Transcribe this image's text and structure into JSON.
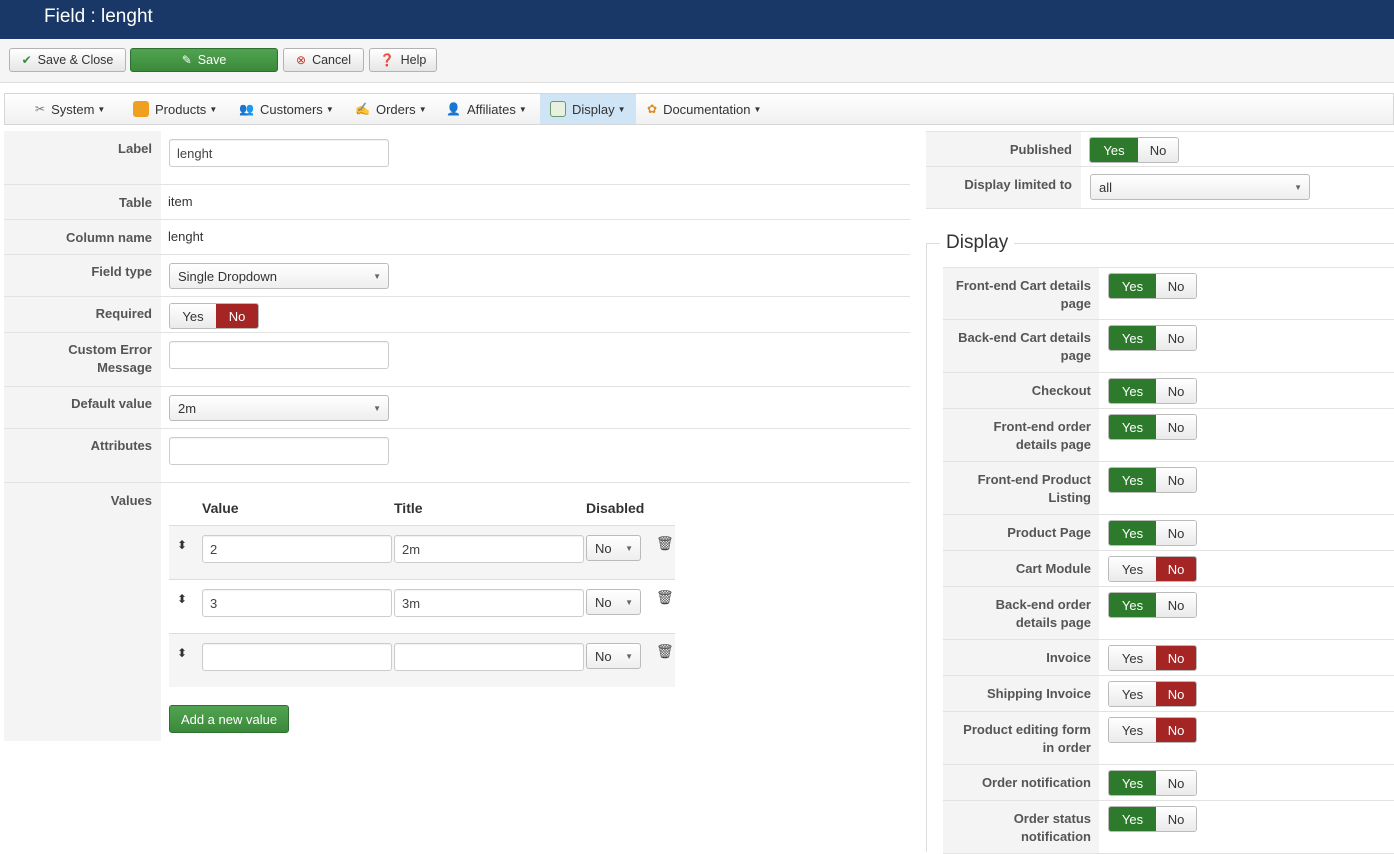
{
  "title": "Field : lenght",
  "toolbar": {
    "save_close": "Save & Close",
    "save": "Save",
    "cancel": "Cancel",
    "help": "Help"
  },
  "menu": [
    {
      "label": "System",
      "icon": "tools-icon"
    },
    {
      "label": "Products",
      "icon": "products-icon"
    },
    {
      "label": "Customers",
      "icon": "customers-icon"
    },
    {
      "label": "Orders",
      "icon": "orders-icon"
    },
    {
      "label": "Affiliates",
      "icon": "affiliates-icon"
    },
    {
      "label": "Display",
      "icon": "display-icon",
      "active": true
    },
    {
      "label": "Documentation",
      "icon": "documentation-icon"
    }
  ],
  "form": {
    "label": {
      "label": "Label",
      "value": "lenght"
    },
    "table": {
      "label": "Table",
      "value": "item"
    },
    "column_name": {
      "label": "Column name",
      "value": "lenght"
    },
    "field_type": {
      "label": "Field type",
      "value": "Single Dropdown"
    },
    "required": {
      "label": "Required",
      "yes": "Yes",
      "no": "No",
      "selected": "no"
    },
    "custom_error": {
      "label_1": "Custom Error",
      "label_2": "Message",
      "value": ""
    },
    "default_value": {
      "label": "Default value",
      "value": "2m"
    },
    "attributes": {
      "label": "Attributes",
      "value": ""
    },
    "values": {
      "label": "Values",
      "col_value": "Value",
      "col_title": "Title",
      "col_disabled": "Disabled",
      "rows": [
        {
          "value": "2",
          "title": "2m",
          "disabled": "No"
        },
        {
          "value": "3",
          "title": "3m",
          "disabled": "No"
        },
        {
          "value": "",
          "title": "",
          "disabled": "No"
        }
      ],
      "add_button": "Add a new value"
    }
  },
  "right": {
    "published": {
      "label": "Published",
      "yes": "Yes",
      "no": "No",
      "selected": "yes"
    },
    "display_limited": {
      "label": "Display limited to",
      "value": "all"
    },
    "display_legend": "Display",
    "display_rows": [
      {
        "label_1": "Front-end Cart details",
        "label_2": "page",
        "selected": "yes"
      },
      {
        "label_1": "Back-end Cart details",
        "label_2": "page",
        "selected": "yes"
      },
      {
        "label_1": "Checkout",
        "label_2": "",
        "selected": "yes"
      },
      {
        "label_1": "Front-end order",
        "label_2": "details page",
        "selected": "yes"
      },
      {
        "label_1": "Front-end Product",
        "label_2": "Listing",
        "selected": "yes"
      },
      {
        "label_1": "Product Page",
        "label_2": "",
        "selected": "yes"
      },
      {
        "label_1": "Cart Module",
        "label_2": "",
        "selected": "no"
      },
      {
        "label_1": "Back-end order",
        "label_2": "details page",
        "selected": "yes"
      },
      {
        "label_1": "Invoice",
        "label_2": "",
        "selected": "no"
      },
      {
        "label_1": "Shipping Invoice",
        "label_2": "",
        "selected": "no"
      },
      {
        "label_1": "Product editing form",
        "label_2": "in order",
        "selected": "no"
      },
      {
        "label_1": "Order notification",
        "label_2": "",
        "selected": "yes"
      },
      {
        "label_1": "Order status",
        "label_2": "notification",
        "selected": "yes"
      }
    ],
    "yes": "Yes",
    "no": "No"
  }
}
